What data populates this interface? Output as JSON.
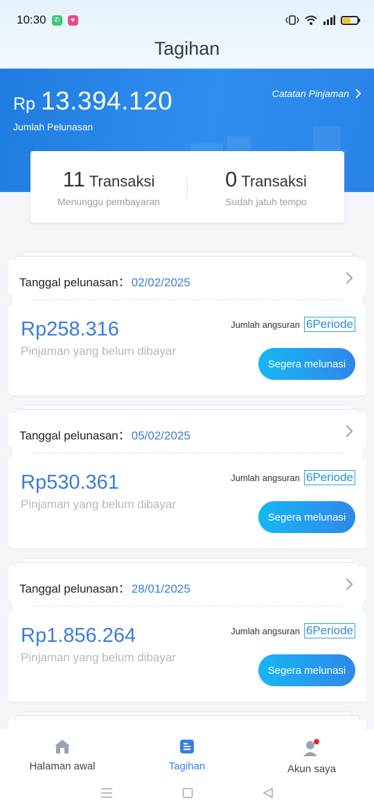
{
  "status_bar": {
    "time": "10:30"
  },
  "header": {
    "title": "Tagihan"
  },
  "banner": {
    "currency": "Rp",
    "total_amount": "13.394.120",
    "amount_label": "Jumlah Pelunasan",
    "history_link": "Catatan Pinjaman",
    "pending": {
      "count": "11",
      "unit": "Transaksi",
      "label": "Menunggu pembayaran"
    },
    "overdue": {
      "count": "0",
      "unit": "Transaksi",
      "label": "Sudah jatuh tempo"
    }
  },
  "bills": [
    {
      "date_label": "Tanggal pelunasan：",
      "date": "02/02/2025",
      "amount": "Rp258.316",
      "amount_label": "Pinjaman yang belum dibayar",
      "installment_label": "Jumlah angsuran",
      "installment": "6Periode",
      "button": "Segera melunasi"
    },
    {
      "date_label": "Tanggal pelunasan：",
      "date": "05/02/2025",
      "amount": "Rp530.361",
      "amount_label": "Pinjaman yang belum dibayar",
      "installment_label": "Jumlah angsuran",
      "installment": "6Periode",
      "button": "Segera melunasi"
    },
    {
      "date_label": "Tanggal pelunasan：",
      "date": "28/01/2025",
      "amount": "Rp1.856.264",
      "amount_label": "Pinjaman yang belum dibayar",
      "installment_label": "Jumlah angsuran",
      "installment": "6Periode",
      "button": "Segera melunasi"
    }
  ],
  "bottom_nav": {
    "items": [
      {
        "label": "Halaman awal",
        "icon": "home-icon"
      },
      {
        "label": "Tagihan",
        "icon": "bill-icon",
        "active": true
      },
      {
        "label": "Akun saya",
        "icon": "account-icon"
      }
    ]
  },
  "colors": {
    "accent": "#3a7dd8",
    "banner": "#2a88ee",
    "button_start": "#16b6f6",
    "button_end": "#2f88ea"
  }
}
